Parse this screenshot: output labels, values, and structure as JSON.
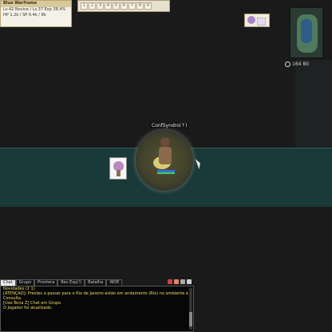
{
  "status": {
    "title": "Blue Warframe",
    "lines": [
      "Lv.42 Novice / Lv.37 Exp 38.4%",
      "HP 1.2k / SP 0.4k / 8k"
    ]
  },
  "hotbar": {
    "slots": [
      "1",
      "2",
      "3",
      "4",
      "5",
      "6",
      "7",
      "8",
      "9"
    ]
  },
  "map": {
    "coords": "164 80"
  },
  "player": {
    "name": "ConfSyndro(↑)"
  },
  "chat": {
    "tabs": [
      "Chat",
      "Grupo",
      "Prontera",
      "Rec.Exp(!)",
      "Batalha",
      "WOE"
    ],
    "messages": [
      "Novidades (2 1)",
      "[ATENÇÃO]: Prestes a passar para o Rio de Janeiro estão em andamento (Rio) no ambiente eventos do",
      "Consulta.",
      "[Use:Tecla Z] Chat em Grupo",
      "O Jogador foi atualizado."
    ]
  },
  "colors": {
    "band": "#193a38",
    "panel": "#f4f1e6",
    "chat_text": "#f0dd6a"
  }
}
